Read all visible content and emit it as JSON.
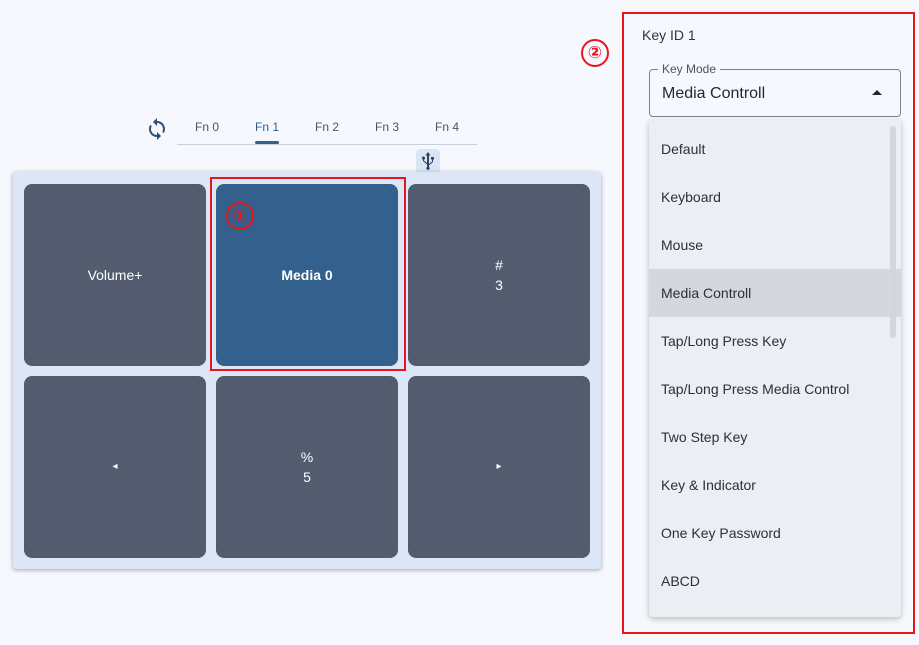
{
  "tabs": [
    {
      "label": "Fn 0",
      "active": false
    },
    {
      "label": "Fn 1",
      "active": true
    },
    {
      "label": "Fn 2",
      "active": false
    },
    {
      "label": "Fn 3",
      "active": false
    },
    {
      "label": "Fn 4",
      "active": false
    }
  ],
  "icons": {
    "sync": "sync-icon",
    "usb": "usb-icon",
    "dropdown_caret": "caret-up-icon"
  },
  "keys": [
    {
      "label": "Volume+",
      "selected": false
    },
    {
      "label": "Media 0",
      "selected": true
    },
    {
      "label": "#",
      "sublabel": "3",
      "selected": false
    },
    {
      "label": "◂",
      "selected": false
    },
    {
      "label": "%",
      "sublabel": "5",
      "selected": false
    },
    {
      "label": "▸",
      "selected": false
    }
  ],
  "callouts": [
    "①",
    "②"
  ],
  "panel": {
    "title": "Key ID 1",
    "key_mode_label": "Key Mode",
    "key_mode_value": "Media Controll",
    "options": [
      "Default",
      "Keyboard",
      "Mouse",
      "Media Controll",
      "Tap/Long Press Key",
      "Tap/Long Press Media Control",
      "Two Step Key",
      "Key & Indicator",
      "One Key Password",
      "ABCD"
    ],
    "highlighted_option": "Media Controll"
  },
  "colors": {
    "key": "#525c6e",
    "key_selected": "#34608d",
    "accent": "#355f8c",
    "callout": "#e8151b",
    "keypad_bg": "#dbe6f6",
    "page_bg": "#f6f8fd"
  }
}
